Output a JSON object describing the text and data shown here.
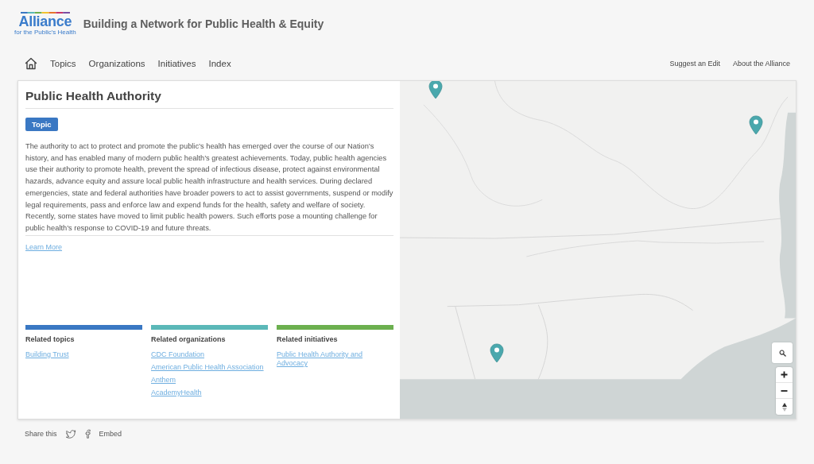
{
  "header": {
    "logo": {
      "wordmark": "Alliance",
      "tagline": "for the Public’s Health"
    },
    "title": "Building a Network for Public Health & Equity"
  },
  "nav": {
    "items": [
      "Topics",
      "Organizations",
      "Initiatives",
      "Index"
    ],
    "links_right": [
      "Suggest an Edit",
      "About the Alliance"
    ]
  },
  "panel": {
    "title": "Public Health Authority",
    "badge": "Topic",
    "description": "The authority to act to protect and promote the public’s health has emerged over the course of our Nation’s history, and has enabled many of modern public health’s greatest achievements. Today, public health agencies use their authority to promote health, prevent the spread of infectious disease, protect against environmental hazards, advance equity and assure local public health infrastructure and health services. During declared emergencies, state and federal authorities have broader powers to act to assist governments, suspend or modify legal requirements, pass and enforce law and expend funds for the health, safety and welfare of society. Recently, some states have moved to limit public health powers. Such efforts pose a mounting challenge for public health’s response to COVID-19 and future threats.",
    "learn_more": "Learn More",
    "related": [
      {
        "heading": "Related topics",
        "color": "#3a78c3",
        "links": [
          "Building Trust"
        ]
      },
      {
        "heading": "Related organizations",
        "color": "#5bb8b8",
        "links": [
          "CDC Foundation",
          "American Public Health Association",
          "Anthem",
          "AcademyHealth"
        ]
      },
      {
        "heading": "Related initiatives",
        "color": "#6cb04f",
        "links": [
          "Public Health Authority and Advocacy"
        ]
      }
    ]
  },
  "footer": {
    "share_label": "Share this",
    "embed_label": "Embed"
  }
}
